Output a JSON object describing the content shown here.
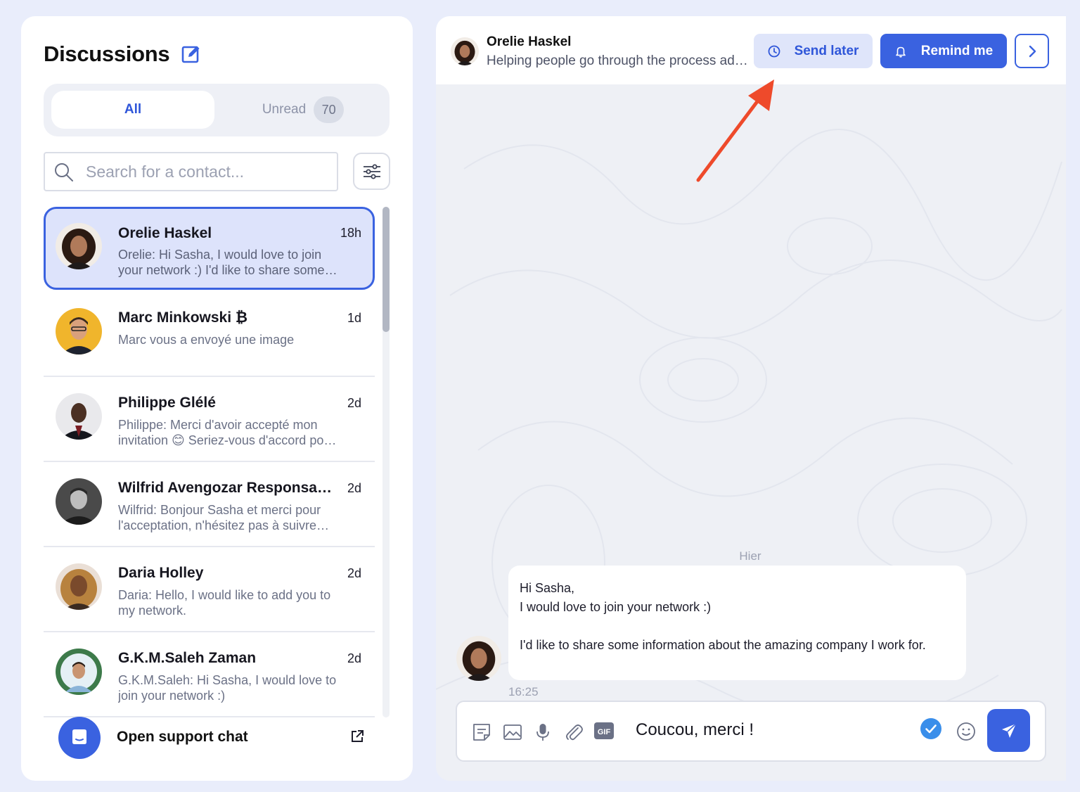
{
  "sidebar": {
    "title": "Discussions",
    "tabs": {
      "all_label": "All",
      "unread_label": "Unread",
      "unread_count": "70"
    },
    "search": {
      "placeholder": "Search for a contact...",
      "value": ""
    },
    "contacts": [
      {
        "name": "Orelie Haskel",
        "time": "18h",
        "preview": "Orelie: Hi Sasha, I would love to join your network :) I'd like to share some information about the amazing company I work for.",
        "active": true
      },
      {
        "name": "Marc Minkowski ₿",
        "time": "1d",
        "preview": "Marc vous a envoyé une image",
        "active": false
      },
      {
        "name": "Philippe Glélé",
        "time": "2d",
        "preview": "Philippe: Merci d'avoir accepté mon invitation 😊 Seriez-vous d'accord pour échanger ?",
        "active": false
      },
      {
        "name": "Wilfrid Avengozar Responsable",
        "time": "2d",
        "preview": "Wilfrid: Bonjour Sasha et merci pour l'acceptation, n'hésitez pas à suivre mes publications",
        "active": false
      },
      {
        "name": "Daria Holley",
        "time": "2d",
        "preview": "Daria: Hello, I would like to add you to my network.",
        "active": false
      },
      {
        "name": "G.K.M.Saleh Zaman",
        "time": "2d",
        "preview": "G.K.M.Saleh: Hi Sasha, I would love to join your network :)",
        "active": false
      }
    ],
    "support_label": "Open support chat"
  },
  "chat": {
    "header": {
      "name": "Orelie Haskel",
      "subtitle": "Helping people go through the process ad…",
      "send_later_label": "Send later",
      "remind_me_label": "Remind me"
    },
    "date_separator": "Hier",
    "message": {
      "lines": [
        "Hi Sasha,",
        "I would love to join your network :)",
        "",
        "I'd like to share some information about the amazing company I work for."
      ],
      "time": "16:25"
    },
    "composer": {
      "value": "Coucou, merci !",
      "gif_label": "GIF"
    }
  },
  "icons": {
    "edit": "edit-icon",
    "search": "search-icon",
    "filter": "sliders-icon",
    "clock": "clock-icon",
    "bell": "bell-icon",
    "chevron": "chevron-right-icon",
    "note": "note-icon",
    "image": "image-icon",
    "mic": "microphone-icon",
    "attach": "paperclip-icon",
    "gif": "gif-icon",
    "check": "check-circle-icon",
    "emoji": "emoji-icon",
    "send": "send-icon",
    "support": "chat-bubble-icon",
    "external": "external-link-icon"
  },
  "colors": {
    "accent": "#3a62e0",
    "accent_light": "#dfe5fa",
    "active_row": "#dde3fb",
    "annotation": "#ee4a2b"
  }
}
